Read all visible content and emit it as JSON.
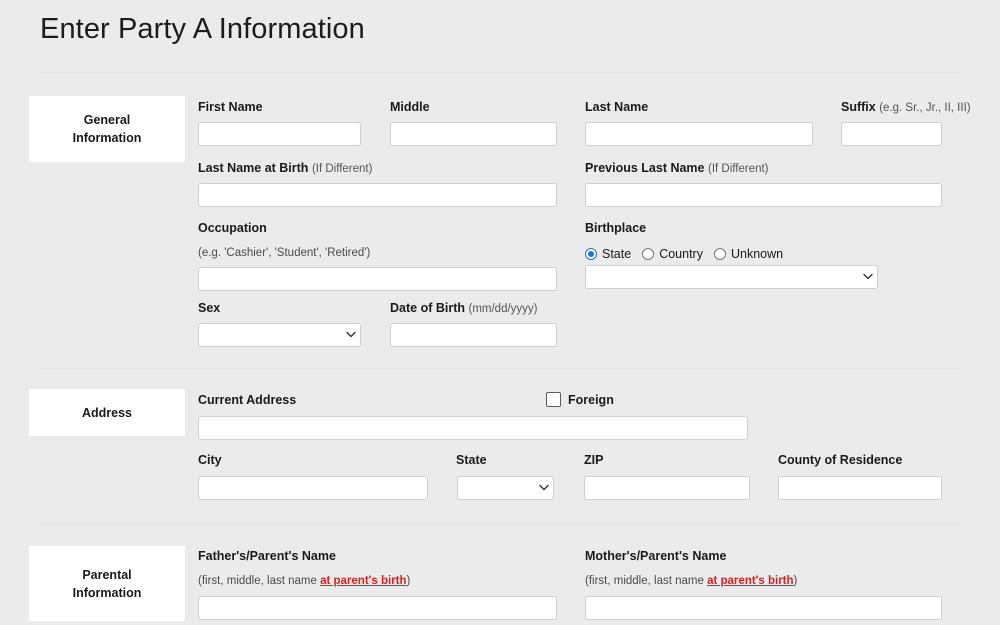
{
  "page": {
    "title": "Enter Party A Information",
    "background_color": "#ebebeb",
    "accent_color": "#1a73e8",
    "alert_color": "#e02020"
  },
  "sections": {
    "general": {
      "tab_line1": "General",
      "tab_line2": "Information",
      "fields": {
        "first_name": {
          "label": "First Name",
          "value": "",
          "placeholder": ""
        },
        "middle": {
          "label": "Middle",
          "value": "",
          "placeholder": ""
        },
        "last_name": {
          "label": "Last Name",
          "value": "",
          "placeholder": ""
        },
        "suffix": {
          "label": "Suffix",
          "hint": "(e.g. Sr., Jr., II, III)",
          "value": "",
          "placeholder": ""
        },
        "last_name_at_birth": {
          "label": "Last Name at Birth",
          "hint": "(If Different)",
          "value": "",
          "placeholder": ""
        },
        "previous_last_name": {
          "label": "Previous Last Name",
          "hint": "(If Different)",
          "value": "",
          "placeholder": ""
        },
        "occupation": {
          "label": "Occupation",
          "sub_hint": "(e.g. 'Cashier', 'Student', 'Retired')",
          "value": "",
          "placeholder": ""
        },
        "sex": {
          "label": "Sex",
          "selected": "",
          "options": [
            ""
          ]
        },
        "date_of_birth": {
          "label": "Date of Birth",
          "hint": "(mm/dd/yyyy)",
          "value": "",
          "placeholder": ""
        },
        "birthplace": {
          "label": "Birthplace",
          "radios": [
            {
              "label": "State",
              "checked": true
            },
            {
              "label": "Country",
              "checked": false
            },
            {
              "label": "Unknown",
              "checked": false
            }
          ],
          "selected": "",
          "options": [
            ""
          ]
        }
      }
    },
    "address": {
      "tab_line1": "Address",
      "tab_line2": "",
      "fields": {
        "current_address": {
          "label": "Current Address",
          "value": "",
          "placeholder": ""
        },
        "foreign": {
          "label": "Foreign",
          "checked": false
        },
        "city": {
          "label": "City",
          "value": "",
          "placeholder": ""
        },
        "state": {
          "label": "State",
          "selected": "",
          "options": [
            ""
          ]
        },
        "zip": {
          "label": "ZIP",
          "value": "",
          "placeholder": ""
        },
        "county_of_residence": {
          "label": "County of Residence",
          "value": "",
          "placeholder": ""
        }
      }
    },
    "parental": {
      "tab_line1": "Parental",
      "tab_line2": "Information",
      "fields": {
        "father_name": {
          "label": "Father's/Parent's Name",
          "hint_plain": "(first, middle, last name ",
          "hint_red": "at parent's birth",
          "hint_tail": ")",
          "value": "",
          "placeholder": ""
        },
        "mother_name": {
          "label": "Mother's/Parent's Name",
          "hint_plain": "(first, middle, last name ",
          "hint_red": "at parent's birth",
          "hint_tail": ")",
          "value": "",
          "placeholder": ""
        }
      }
    }
  }
}
